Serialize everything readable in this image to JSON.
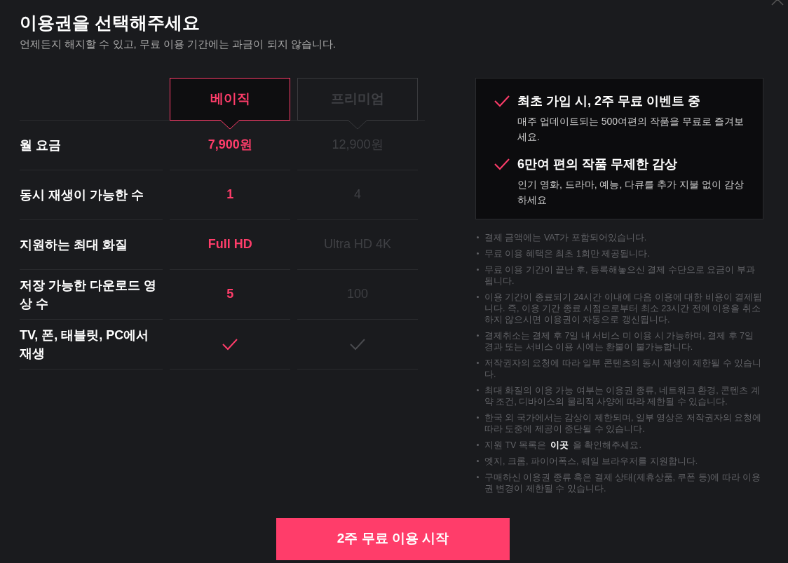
{
  "title": "이용권을 선택해주세요",
  "subtitle": "언제든지 해지할 수 있고, 무료 이용 기간에는 과금이 되지 않습니다.",
  "plans": [
    {
      "name": "베이직",
      "selected": true
    },
    {
      "name": "프리미엄",
      "selected": false
    }
  ],
  "rows": [
    {
      "label": "월 요금",
      "kind": "text",
      "values": [
        "7,900원",
        "12,900원"
      ]
    },
    {
      "label": "동시 재생이 가능한 수",
      "kind": "text",
      "values": [
        "1",
        "4"
      ]
    },
    {
      "label": "지원하는 최대 화질",
      "kind": "text",
      "values": [
        "Full HD",
        "Ultra HD 4K"
      ]
    },
    {
      "label": "저장 가능한 다운로드 영상 수",
      "kind": "text",
      "values": [
        "5",
        "100"
      ]
    },
    {
      "label": "TV, 폰, 태블릿, PC에서 재생",
      "kind": "check",
      "values": [
        true,
        true
      ]
    }
  ],
  "benefits": [
    {
      "title": "최초 가입 시, 2주 무료 이벤트 중",
      "description": "매주 업데이트되는 500여편의 작품을 무료로 즐겨보세요."
    },
    {
      "title": "6만여 편의 작품 무제한 감상",
      "description": "인기 영화, 드라마, 예능, 다큐를 추가 지불 없이 감상하세요"
    }
  ],
  "notes": [
    {
      "text": "결제 금액에는 VAT가 포함되어있습니다."
    },
    {
      "text": "무료 이용 혜택은 최초 1회만 제공됩니다."
    },
    {
      "text": "무료 이용 기간이 끝난 후, 등록해놓으신 결제 수단으로 요금이 부과됩니다."
    },
    {
      "text": "이용 기간이 종료되기 24시간 이내에 다음 이용에 대한 비용이 결제됩니다. 즉, 이용 기간 종료 시점으로부터 최소 23시간 전에 이용을 취소하지 않으시면 이용권이 자동으로 갱신됩니다."
    },
    {
      "text": "결제취소는 결제 후 7일 내 서비스 미 이용 시 가능하며, 결제 후 7일 경과 또는 서비스 이용 시에는 환불이 불가능합니다."
    },
    {
      "text": "저작권자의 요청에 따라 일부 콘텐츠의 동시 재생이 제한될 수 있습니다."
    },
    {
      "text": "최대 화질의 이용 가능 여부는 이용권 종류, 네트워크 환경, 콘텐츠 계약 조건, 디바이스의 물리적 사양에 따라 제한될 수 있습니다."
    },
    {
      "text": "한국 외 국가에서는 감상이 제한되며, 일부 영상은 저작권자의 요청에 따라 도중에 제공이 중단될 수 있습니다."
    },
    {
      "text": "지원 TV 목록은",
      "link": "이곳",
      "after": "을 확인해주세요."
    },
    {
      "text": "엣지, 크롬, 파이어폭스, 웨일 브라우저를 지원합니다."
    },
    {
      "text": "구매하신 이용권 종류 혹은 결제 상태(제휴상품, 쿠폰 등)에 따라 이용권 변경이 제한될 수 있습니다."
    }
  ],
  "cta": "2주 무료 이용 시작"
}
